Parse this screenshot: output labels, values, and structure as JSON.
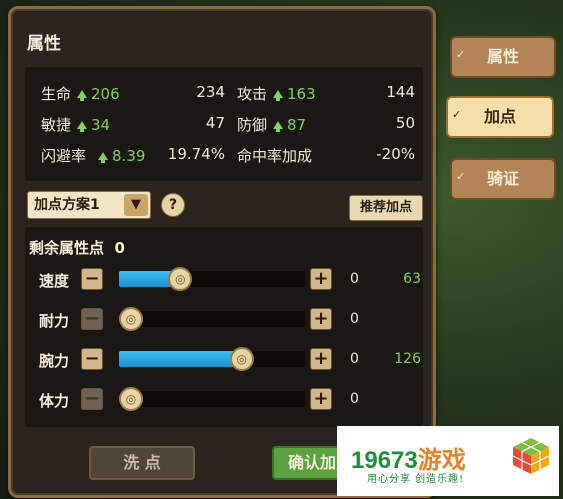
{
  "panel": {
    "title": "属性"
  },
  "stats": [
    {
      "label": "生命",
      "bonus": "206",
      "value": "234"
    },
    {
      "label": "攻击",
      "bonus": "163",
      "value": "144"
    },
    {
      "label": "敏捷",
      "bonus": "34",
      "value": "47"
    },
    {
      "label": "防御",
      "bonus": "87",
      "value": "50"
    },
    {
      "label": "闪避率",
      "bonus": "8.39",
      "value": "19.74%"
    },
    {
      "label": "命中率加成",
      "bonus": "",
      "value": "-20%"
    }
  ],
  "scheme": {
    "selected": "加点方案1",
    "help": "?",
    "recommend_label": "推荐加点"
  },
  "remaining": {
    "label": "剩余属性点",
    "value": "0"
  },
  "attributes": [
    {
      "label": "速度",
      "added": "0",
      "result": "63",
      "level": 0.33
    },
    {
      "label": "耐力",
      "added": "0",
      "result": "",
      "level": 0.0
    },
    {
      "label": "腕力",
      "added": "0",
      "result": "126",
      "level": 0.66
    },
    {
      "label": "体力",
      "added": "0",
      "result": "",
      "level": 0.0
    }
  ],
  "buttons": {
    "wash_label": "洗 点",
    "confirm_label": "确认加点"
  },
  "tabs": [
    {
      "label": "属性",
      "active": false
    },
    {
      "label": "加点",
      "active": true
    },
    {
      "label": "骑证",
      "active": false
    }
  ],
  "watermark": {
    "number": "19673",
    "word": "游戏",
    "slogan": "用心分享 创造乐趣!"
  },
  "colors": {
    "bonus": "#7ed257",
    "bar": "#1a8fd0",
    "confirm": "#5aa33e"
  }
}
